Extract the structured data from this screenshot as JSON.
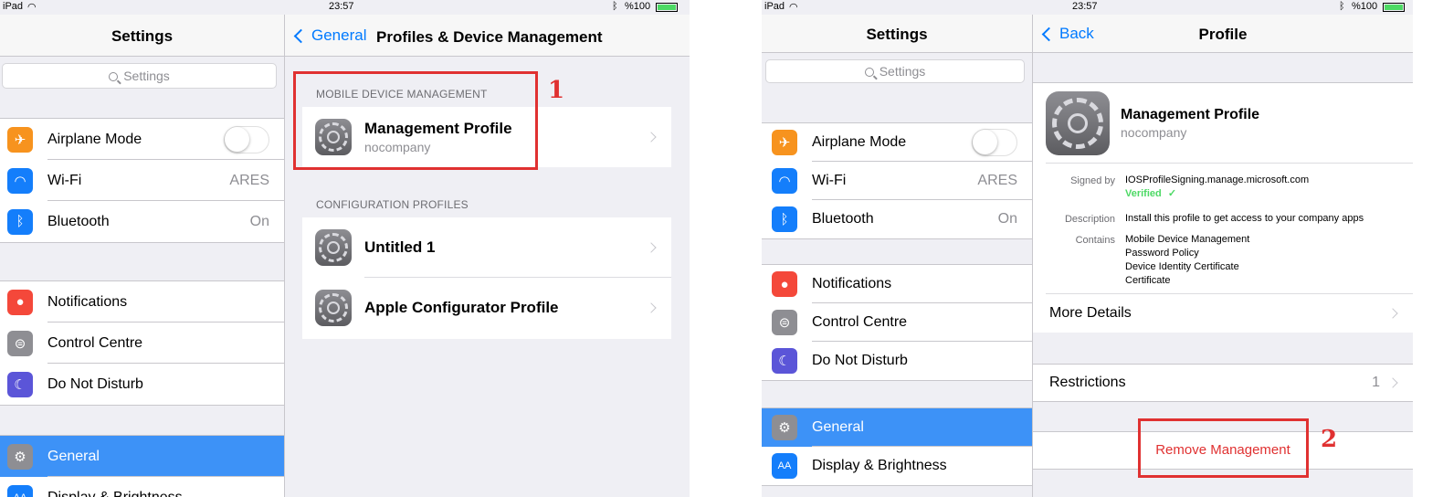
{
  "left": {
    "status": {
      "device": "iPad",
      "time": "23:57",
      "battery": "%100"
    },
    "sidebar": {
      "title": "Settings",
      "search_placeholder": "Settings",
      "groups": [
        [
          {
            "label": "Airplane Mode",
            "value": "",
            "icon": "airplane-icon",
            "color": "#f7931e",
            "toggle": true
          },
          {
            "label": "Wi-Fi",
            "value": "ARES",
            "icon": "wifi-icon",
            "color": "#147efb"
          },
          {
            "label": "Bluetooth",
            "value": "On",
            "icon": "bluetooth-icon",
            "color": "#147efb"
          }
        ],
        [
          {
            "label": "Notifications",
            "value": "",
            "icon": "notifications-icon",
            "color": "#f4483a"
          },
          {
            "label": "Control Centre",
            "value": "",
            "icon": "control-centre-icon",
            "color": "#8e8e93"
          },
          {
            "label": "Do Not Disturb",
            "value": "",
            "icon": "moon-icon",
            "color": "#5b55d8"
          }
        ],
        [
          {
            "label": "General",
            "value": "",
            "icon": "gear-icon",
            "color": "#8e8e93",
            "selected": true
          },
          {
            "label": "Display & Brightness",
            "value": "",
            "icon": "display-icon",
            "color": "#147efb"
          }
        ]
      ]
    },
    "detail": {
      "back_label": "General",
      "title": "Profiles & Device Management",
      "mdm_header": "MOBILE DEVICE MANAGEMENT",
      "mdm_profile": {
        "name": "Management Profile",
        "org": "nocompany"
      },
      "config_header": "CONFIGURATION PROFILES",
      "config_profiles": [
        "Untitled 1",
        "Apple Configurator Profile"
      ]
    },
    "annotation_number": "1"
  },
  "right": {
    "status": {
      "device": "iPad",
      "time": "23:57",
      "battery": "%100"
    },
    "sidebar": {
      "title": "Settings",
      "search_placeholder": "Settings",
      "groups": [
        [
          {
            "label": "Airplane Mode",
            "value": "",
            "icon": "airplane-icon",
            "color": "#f7931e",
            "toggle": true
          },
          {
            "label": "Wi-Fi",
            "value": "ARES",
            "icon": "wifi-icon",
            "color": "#147efb"
          },
          {
            "label": "Bluetooth",
            "value": "On",
            "icon": "bluetooth-icon",
            "color": "#147efb"
          }
        ],
        [
          {
            "label": "Notifications",
            "value": "",
            "icon": "notifications-icon",
            "color": "#f4483a"
          },
          {
            "label": "Control Centre",
            "value": "",
            "icon": "control-centre-icon",
            "color": "#8e8e93"
          },
          {
            "label": "Do Not Disturb",
            "value": "",
            "icon": "moon-icon",
            "color": "#5b55d8"
          }
        ],
        [
          {
            "label": "General",
            "value": "",
            "icon": "gear-icon",
            "color": "#8e8e93",
            "selected": true
          },
          {
            "label": "Display & Brightness",
            "value": "",
            "icon": "display-icon",
            "color": "#147efb"
          }
        ]
      ]
    },
    "detail": {
      "back_label": "Back",
      "title": "Profile",
      "profile": {
        "name": "Management Profile",
        "org": "nocompany"
      },
      "signed_by_key": "Signed by",
      "signed_by_value": "IOSProfileSigning.manage.microsoft.com",
      "verified": "Verified",
      "description_key": "Description",
      "description_value": "Install this profile to get access to your company apps",
      "contains_key": "Contains",
      "contains_values": [
        "Mobile Device Management",
        "Password Policy",
        "Device Identity Certificate",
        "Certificate"
      ],
      "more_details": "More Details",
      "restrictions": "Restrictions",
      "restrictions_count": "1",
      "remove_label": "Remove Management"
    },
    "annotation_number": "2"
  },
  "colors": {
    "accent": "#007aff",
    "selected": "#3d92f7",
    "destructive": "#e03131",
    "verified": "#4cd964"
  }
}
